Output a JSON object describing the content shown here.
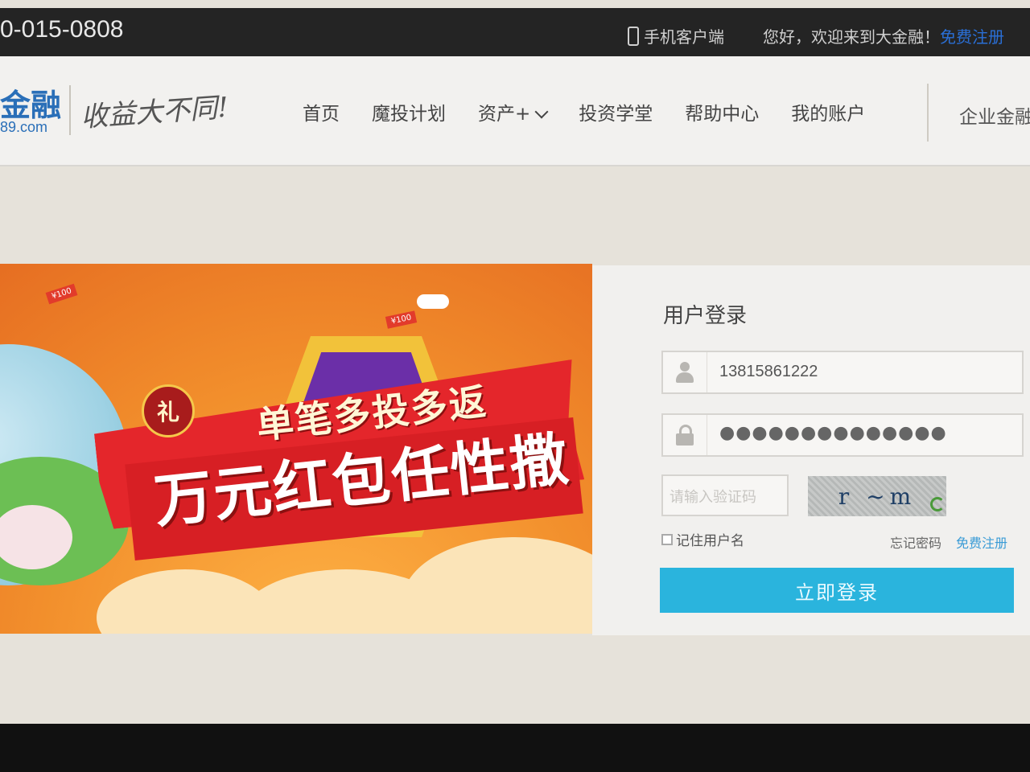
{
  "topbar": {
    "phone": "0-015-0808",
    "mobile_client": "手机客户端",
    "welcome": "您好，欢迎来到大金融！",
    "register": "免费注册"
  },
  "header": {
    "logo_main": "金融",
    "logo_sub": "89.com",
    "slogan": "收益大不同!",
    "nav": [
      {
        "label": "首页"
      },
      {
        "label": "魔投计划"
      },
      {
        "label": "资产+"
      },
      {
        "label": "投资学堂"
      },
      {
        "label": "帮助中心"
      },
      {
        "label": "我的账户"
      }
    ],
    "enterprise": "企业金融"
  },
  "banner": {
    "badge": "礼",
    "headline1": "单笔多投多返",
    "headline2": "万元红包任性撒",
    "note1": "¥100",
    "note2": "¥100"
  },
  "login": {
    "title": "用户登录",
    "username_value": "13815861222",
    "password_dots": "●●●●●●●●●●●●●●",
    "captcha_placeholder": "请输入验证码",
    "captcha_text": "r ~m",
    "remember_label": "记住用户名",
    "forgot_label": "忘记密码",
    "register_label": "免费注册",
    "submit_label": "立即登录"
  },
  "colors": {
    "accent_blue": "#2ab4dd",
    "banner_orange": "#f28f2c",
    "ribbon_red": "#e4262b"
  }
}
